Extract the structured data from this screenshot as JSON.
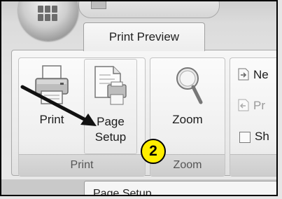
{
  "tab": {
    "label": "Print Preview"
  },
  "groups": {
    "print": {
      "label": "Print",
      "buttons": {
        "print": "Print",
        "page_setup_line1": "Page",
        "page_setup_line2": "Setup"
      }
    },
    "zoom": {
      "label": "Zoom",
      "buttons": {
        "zoom": "Zoom"
      }
    },
    "preview": {
      "items": [
        {
          "label": "Ne",
          "enabled": true
        },
        {
          "label": "Pr",
          "enabled": false
        },
        {
          "label": "Sh",
          "enabled": true,
          "checkbox": true
        }
      ]
    }
  },
  "annotation": {
    "number": "2",
    "color": "#ffee00"
  },
  "document_tab": {
    "label": "Page Setup"
  },
  "icons": [
    "office-button-icon",
    "printer-icon",
    "page-setup-icon",
    "magnifier-icon",
    "next-page-icon",
    "previous-page-icon",
    "arrow-annotation-icon"
  ]
}
